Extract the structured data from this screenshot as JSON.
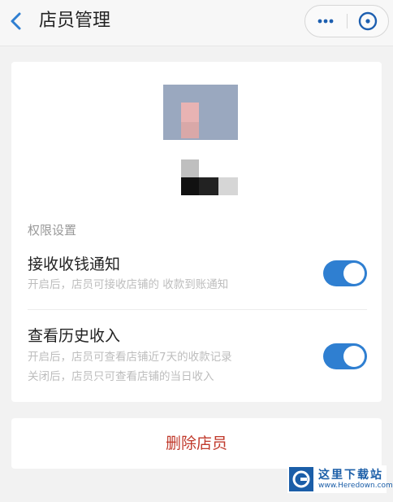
{
  "nav": {
    "title": "店员管理"
  },
  "permissions": {
    "section_label": "权限设置",
    "items": [
      {
        "title": "接收收钱通知",
        "desc_lines": [
          "开启后，店员可接收店铺的 收款到账通知"
        ],
        "enabled": true
      },
      {
        "title": "查看历史收入",
        "desc_lines": [
          "开启后，店员可查看店铺近7天的收款记录",
          "关闭后，店员只可查看店铺的当日收入"
        ],
        "enabled": true
      }
    ]
  },
  "actions": {
    "delete_label": "删除店员"
  },
  "watermark": {
    "title": "这里下载站",
    "url": "www.Heredown.com"
  },
  "colors": {
    "accent": "#2f7fd1",
    "danger": "#c0392b",
    "background": "#f2f2f2"
  }
}
